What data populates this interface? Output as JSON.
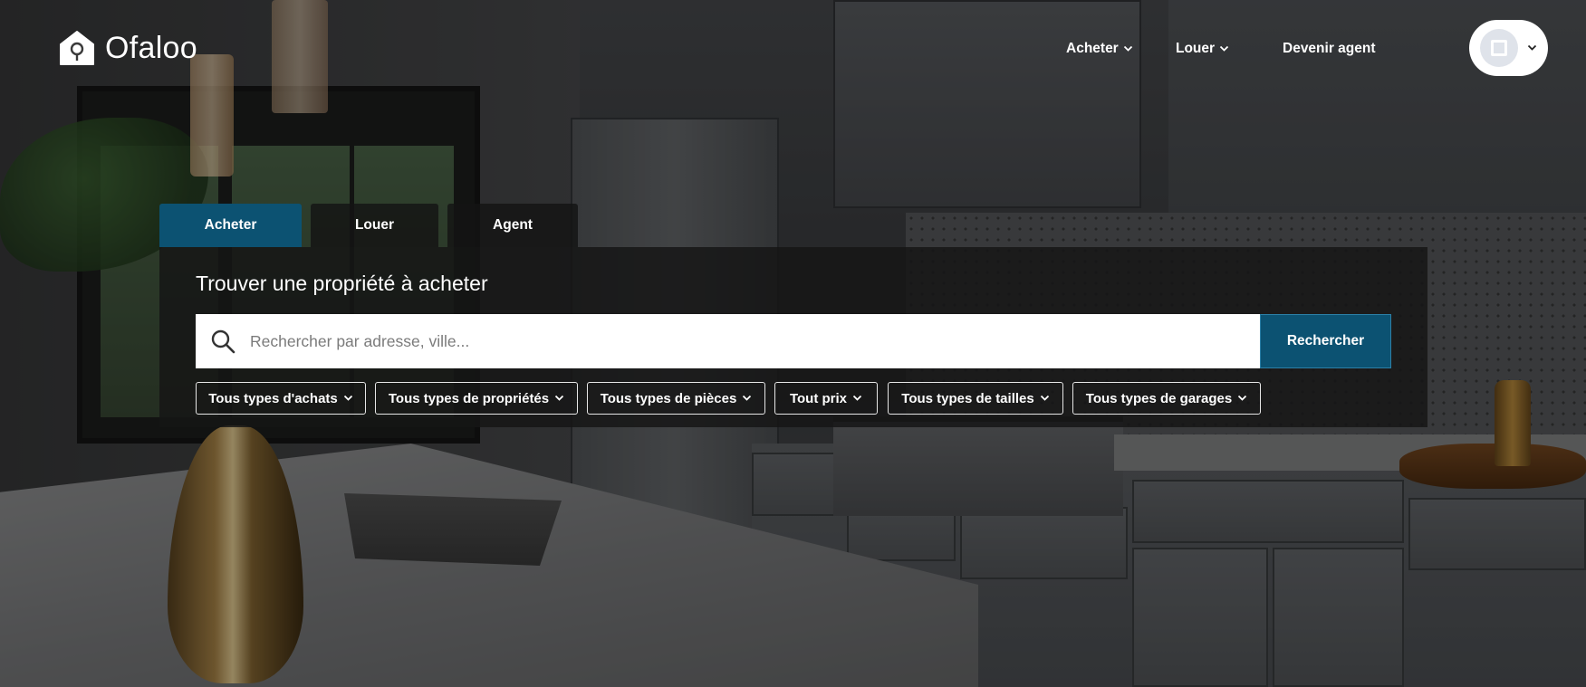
{
  "brand": {
    "name": "Ofaloo",
    "icon": "house-icon"
  },
  "nav": {
    "items": [
      {
        "label": "Acheter",
        "has_dropdown": true
      },
      {
        "label": "Louer",
        "has_dropdown": true
      },
      {
        "label": "Devenir agent",
        "has_dropdown": false
      }
    ]
  },
  "user_menu": {
    "avatar_icon": "user-avatar-icon",
    "chevron_icon": "chevron-down-icon"
  },
  "search": {
    "tabs": [
      {
        "label": "Acheter",
        "active": true
      },
      {
        "label": "Louer",
        "active": false
      },
      {
        "label": "Agent",
        "active": false
      }
    ],
    "title": "Trouver une propriété à acheter",
    "placeholder": "Rechercher par adresse, ville...",
    "value": "",
    "button_label": "Rechercher",
    "filters": [
      "Tous types d'achats",
      "Tous types de propriétés",
      "Tous types de pièces",
      "Tout prix",
      "Tous types de tailles",
      "Tous types de garages"
    ]
  },
  "colors": {
    "accent": "#0c5272",
    "panel_bg": "#161616",
    "text": "#ffffff"
  }
}
